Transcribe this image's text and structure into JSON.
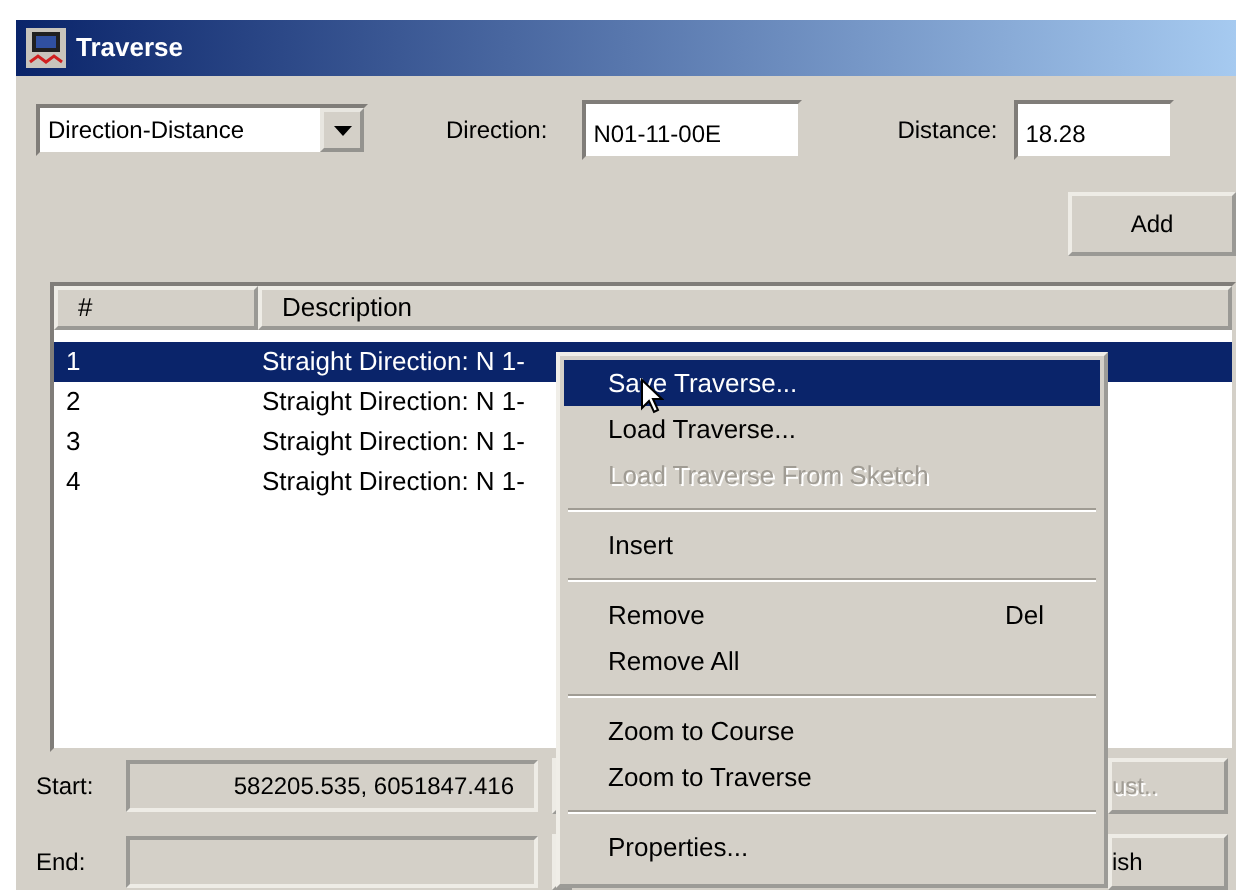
{
  "window": {
    "title": "Traverse"
  },
  "mode_select": {
    "value": "Direction-Distance"
  },
  "direction": {
    "label": "Direction:",
    "value": "N01-11-00E"
  },
  "distance": {
    "label": "Distance:",
    "value": "18.28"
  },
  "add_button": "Add",
  "list": {
    "columns": [
      "#",
      "Description"
    ],
    "rows": [
      {
        "number": "1",
        "description": "Straight Direction: N 1-",
        "selected": true
      },
      {
        "number": "2",
        "description": "Straight Direction: N 1-",
        "selected": false
      },
      {
        "number": "3",
        "description": "Straight Direction: N 1-",
        "selected": false
      },
      {
        "number": "4",
        "description": "Straight Direction: N 1-",
        "selected": false
      }
    ]
  },
  "start": {
    "label": "Start:",
    "value": "582205.535,  6051847.416",
    "button": "ust..",
    "button_disabled": true
  },
  "end": {
    "label": "End:",
    "button": "ish",
    "button_disabled": false
  },
  "context_menu": [
    {
      "kind": "item",
      "label": "Save Traverse...",
      "selected": true,
      "disabled": false
    },
    {
      "kind": "item",
      "label": "Load Traverse...",
      "selected": false,
      "disabled": false
    },
    {
      "kind": "item",
      "label": "Load Traverse From Sketch",
      "selected": false,
      "disabled": true
    },
    {
      "kind": "separator"
    },
    {
      "kind": "item",
      "label": "Insert",
      "selected": false,
      "disabled": false
    },
    {
      "kind": "separator"
    },
    {
      "kind": "item",
      "label": "Remove",
      "shortcut": "Del",
      "selected": false,
      "disabled": false
    },
    {
      "kind": "item",
      "label": "Remove All",
      "selected": false,
      "disabled": false
    },
    {
      "kind": "separator"
    },
    {
      "kind": "item",
      "label": "Zoom to Course",
      "selected": false,
      "disabled": false
    },
    {
      "kind": "item",
      "label": "Zoom to Traverse",
      "selected": false,
      "disabled": false
    },
    {
      "kind": "separator"
    },
    {
      "kind": "item",
      "label": "Properties...",
      "selected": false,
      "disabled": false
    }
  ]
}
